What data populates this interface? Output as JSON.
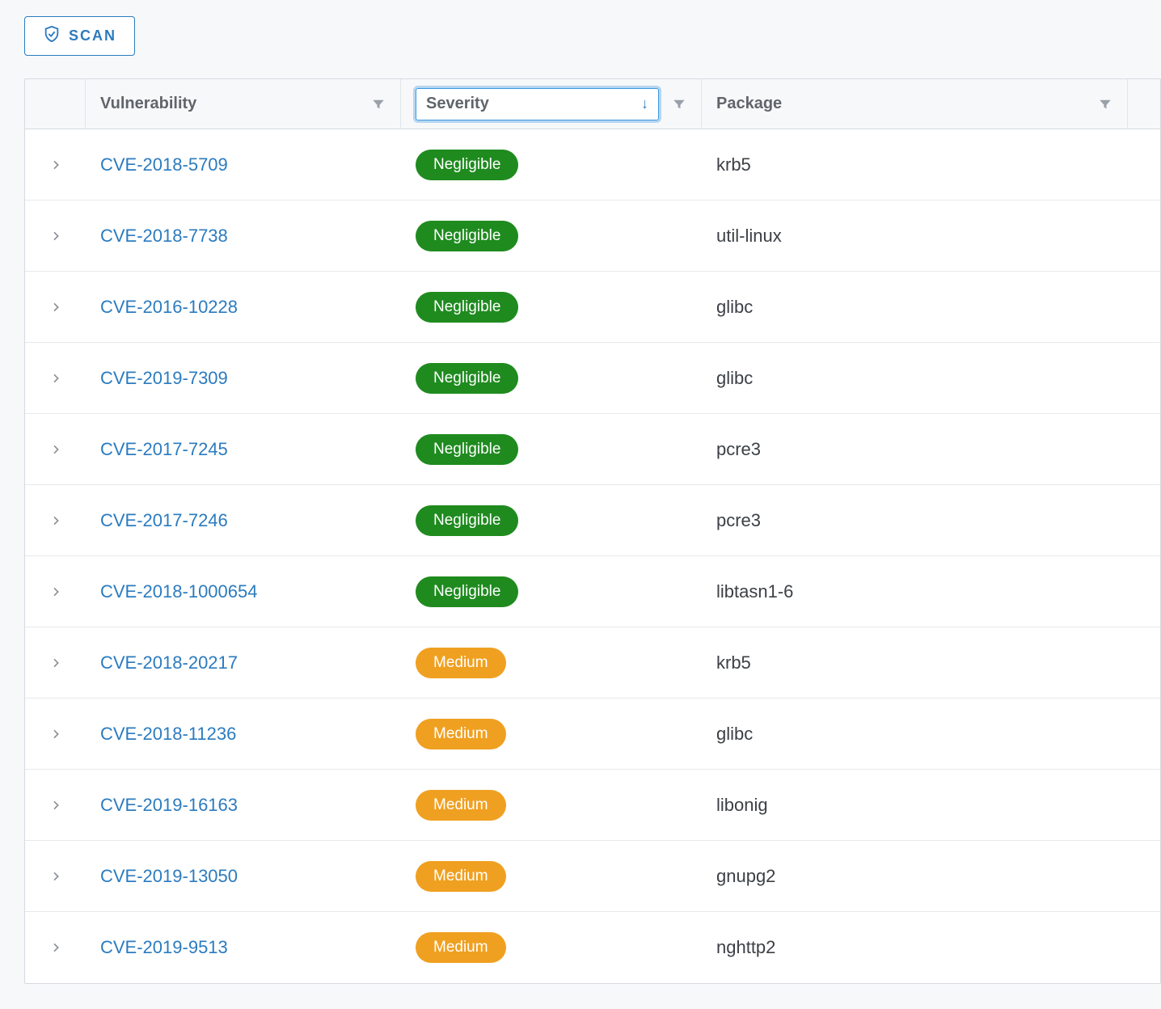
{
  "toolbar": {
    "scan_label": "SCAN"
  },
  "columns": {
    "vulnerability": "Vulnerability",
    "severity": "Severity",
    "package": "Package"
  },
  "severity_labels": {
    "negligible": "Negligible",
    "medium": "Medium"
  },
  "rows": [
    {
      "cve": "CVE-2018-5709",
      "severity": "negligible",
      "package": "krb5"
    },
    {
      "cve": "CVE-2018-7738",
      "severity": "negligible",
      "package": "util-linux"
    },
    {
      "cve": "CVE-2016-10228",
      "severity": "negligible",
      "package": "glibc"
    },
    {
      "cve": "CVE-2019-7309",
      "severity": "negligible",
      "package": "glibc"
    },
    {
      "cve": "CVE-2017-7245",
      "severity": "negligible",
      "package": "pcre3"
    },
    {
      "cve": "CVE-2017-7246",
      "severity": "negligible",
      "package": "pcre3"
    },
    {
      "cve": "CVE-2018-1000654",
      "severity": "negligible",
      "package": "libtasn1-6"
    },
    {
      "cve": "CVE-2018-20217",
      "severity": "medium",
      "package": "krb5"
    },
    {
      "cve": "CVE-2018-11236",
      "severity": "medium",
      "package": "glibc"
    },
    {
      "cve": "CVE-2019-16163",
      "severity": "medium",
      "package": "libonig"
    },
    {
      "cve": "CVE-2019-13050",
      "severity": "medium",
      "package": "gnupg2"
    },
    {
      "cve": "CVE-2019-9513",
      "severity": "medium",
      "package": "nghttp2"
    }
  ]
}
